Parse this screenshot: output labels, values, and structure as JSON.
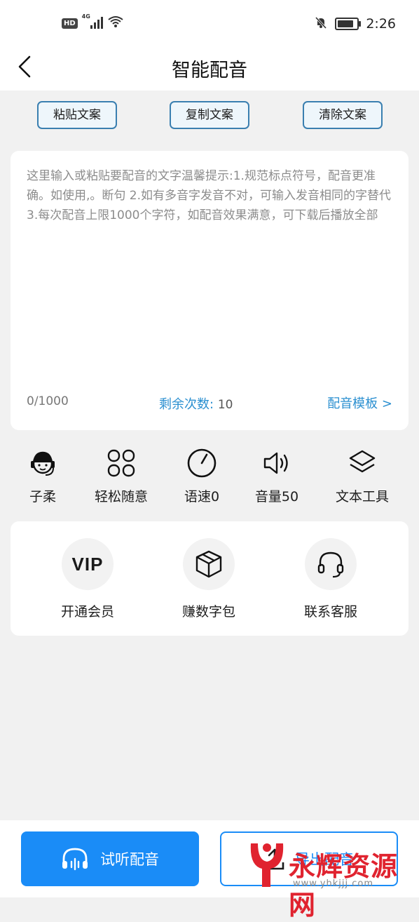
{
  "status_bar": {
    "hd_badge": "HD",
    "network": "4G",
    "time": "2:26"
  },
  "header": {
    "title": "智能配音"
  },
  "text_actions": [
    {
      "label": "粘贴文案"
    },
    {
      "label": "复制文案"
    },
    {
      "label": "清除文案"
    }
  ],
  "editor": {
    "placeholder": "这里输入或粘贴要配音的文字温馨提示:1.规范标点符号，配音更准确。如使用,。断句 2.如有多音字发音不对，可输入发音相同的字替代 3.每次配音上限1000个字符，如配音效果满意，可下载后播放全部",
    "counter": "0/1000",
    "remaining_label": "剩余次数:",
    "remaining_value": "10",
    "template_link": "配音模板 >"
  },
  "tools": [
    {
      "label": "子柔",
      "icon": "voice-avatar-icon"
    },
    {
      "label": "轻松随意",
      "icon": "style-grid-icon"
    },
    {
      "label": "语速0",
      "icon": "speed-gauge-icon"
    },
    {
      "label": "音量50",
      "icon": "volume-icon"
    },
    {
      "label": "文本工具",
      "icon": "layers-icon"
    }
  ],
  "services": [
    {
      "label": "开通会员",
      "icon": "vip-icon",
      "icon_text": "VIP"
    },
    {
      "label": "赚数字包",
      "icon": "package-box-icon"
    },
    {
      "label": "联系客服",
      "icon": "headset-icon"
    }
  ],
  "bottom": {
    "listen_label": "试听配音",
    "export_label": "导出配音"
  },
  "watermark": {
    "brand": "永辉资源网",
    "url": "www.yhkjjj.com"
  },
  "colors": {
    "accent": "#1a8cf7",
    "link": "#2a8fd0",
    "outline": "#3a7fb0",
    "watermark": "#e0232f"
  }
}
